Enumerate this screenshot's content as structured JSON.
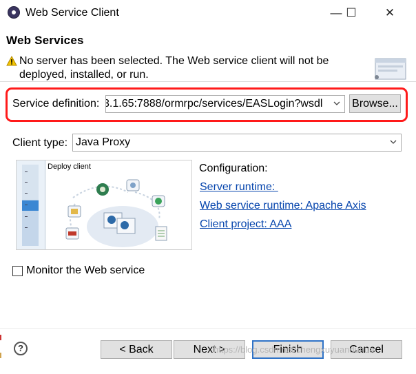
{
  "window": {
    "title": "Web Service Client",
    "buttons": {
      "minimize": "—",
      "maximize": "☐",
      "close": "✕"
    }
  },
  "header": {
    "title": "Web Services",
    "warning": "No server has been selected. The Web service client will not be deployed, installed, or run.",
    "warning_icon": "warning-triangle-icon",
    "banner_icon": "web-service-banner-icon"
  },
  "service": {
    "label": "Service definition:",
    "value": "3.1.65:7888/ormrpc/services/EASLogin?wsdl",
    "browse": "Browse..."
  },
  "client_type": {
    "label": "Client type:",
    "value": "Java Proxy"
  },
  "diagram": {
    "title": "Deploy client",
    "slider_level": 0.55
  },
  "configuration": {
    "heading": "Configuration:",
    "server_runtime": "Server runtime: ",
    "ws_runtime": "Web service runtime: Apache Axis",
    "client_project": "Client project: AAA"
  },
  "monitor": {
    "label": "Monitor the Web service",
    "checked": false
  },
  "footer": {
    "back": "< Back",
    "next": "Next >",
    "finish": "Finish",
    "cancel": "Cancel",
    "watermark": "https://blog.csdn.net/chengxuyuanduhua"
  },
  "colors": {
    "highlight": "#ff1a1a",
    "link": "#0645ad",
    "default_button_border": "#2f73c7"
  }
}
